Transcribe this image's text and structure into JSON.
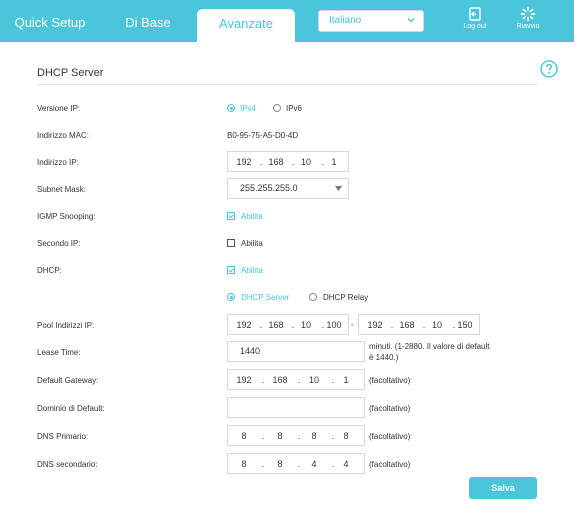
{
  "tabs": [
    {
      "label": "Quick Setup",
      "active": false
    },
    {
      "label": "Di Base",
      "active": false
    },
    {
      "label": "Avanzate",
      "active": true
    }
  ],
  "language": {
    "selected": "Italiano"
  },
  "top_buttons": {
    "logout": "Log out",
    "reboot": "Riavvio"
  },
  "section_title": "DHCP Server",
  "fields": {
    "ip_version": {
      "label": "Versione IP:",
      "options": [
        "IPv4",
        "IPv6"
      ],
      "selected": "IPv4"
    },
    "mac": {
      "label": "Indirizzo MAC:",
      "value": "B0-95-75-A5-D0-4D"
    },
    "ip": {
      "label": "Indirizzo IP:",
      "octets": [
        "192",
        "168",
        "10",
        "1"
      ]
    },
    "subnet": {
      "label": "Subnet Mask:",
      "value": "255.255.255.0"
    },
    "igmp": {
      "label": "IGMP Snooping:",
      "checkbox": "Abilita",
      "checked": true
    },
    "second_ip": {
      "label": "Secondo IP:",
      "checkbox": "Abilita",
      "checked": false
    },
    "dhcp": {
      "label": "DHCP:",
      "checkbox": "Abilita",
      "checked": true,
      "modes": [
        "DHCP Server",
        "DHCP Relay"
      ],
      "mode_selected": "DHCP Server"
    },
    "pool": {
      "label": "Pool Indirizzi IP:",
      "start": [
        "192",
        "168",
        "10",
        "100"
      ],
      "end": [
        "192",
        "168",
        "10",
        "150"
      ]
    },
    "lease": {
      "label": "Lease Time:",
      "value": "1440",
      "hint_1": "minuti. (1-2880. Il valore di default",
      "hint_2": "è 1440.)"
    },
    "gateway": {
      "label": "Default Gateway:",
      "octets": [
        "192",
        "168",
        "10",
        "1"
      ],
      "note": "(facoltativo)"
    },
    "domain": {
      "label": "Dominio di Default:",
      "value": "",
      "note": "(facoltativo)"
    },
    "dns1": {
      "label": "DNS Primario:",
      "octets": [
        "8",
        "8",
        "8",
        "8"
      ],
      "note": "(facoltativo)"
    },
    "dns2": {
      "label": "DNS secondario:",
      "octets": [
        "8",
        "8",
        "4",
        "4"
      ],
      "note": "(facoltativo)"
    }
  },
  "save_label": "Salva",
  "colors": {
    "accent": "#4ac5d9"
  }
}
